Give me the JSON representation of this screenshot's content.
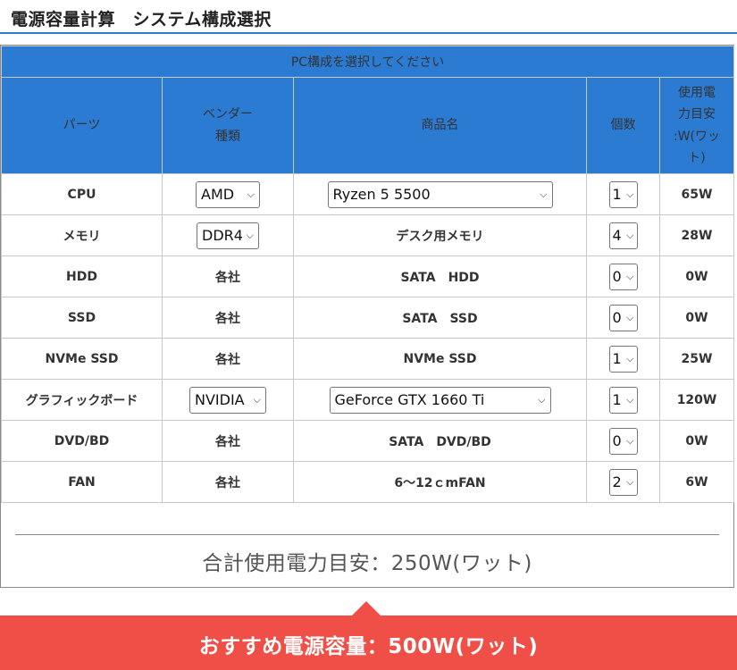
{
  "header": {
    "title": "電源容量計算　システム構成選択"
  },
  "table": {
    "caption": "PC構成を選択してください",
    "headers": {
      "parts": "パーツ",
      "vendor_line1": "ベンダー",
      "vendor_line2": "種類",
      "product": "商品名",
      "qty": "個数",
      "power_line1": "使用電",
      "power_line2": "力目安",
      "power_line3": ":W(ワッ",
      "power_line4": "ト)"
    },
    "rows": [
      {
        "part": "CPU",
        "vendor": "AMD",
        "product": "Ryzen 5 5500",
        "qty": "1",
        "watt": "65W"
      },
      {
        "part": "メモリ",
        "vendor": "DDR4",
        "product": "デスク用メモリ",
        "qty": "4",
        "watt": "28W"
      },
      {
        "part": "HDD",
        "vendor": "各社",
        "product": "SATA　HDD",
        "qty": "0",
        "watt": "0W"
      },
      {
        "part": "SSD",
        "vendor": "各社",
        "product": "SATA　SSD",
        "qty": "0",
        "watt": "0W"
      },
      {
        "part": "NVMe SSD",
        "vendor": "各社",
        "product": "NVMe SSD",
        "qty": "1",
        "watt": "25W"
      },
      {
        "part": "グラフィックボード",
        "vendor": "NVIDIA",
        "product": "GeForce GTX 1660 Ti",
        "qty": "1",
        "watt": "120W"
      },
      {
        "part": "DVD/BD",
        "vendor": "各社",
        "product": "SATA　DVD/BD",
        "qty": "0",
        "watt": "0W"
      },
      {
        "part": "FAN",
        "vendor": "各社",
        "product": "6～12ｃmFAN",
        "qty": "2",
        "watt": "6W"
      }
    ]
  },
  "total": {
    "text": "合計使用電力目安：250W(ワット)"
  },
  "recommend": {
    "text": "おすすめ電源容量：500W(ワット)"
  },
  "colors": {
    "header_blue": "#2b7bd2",
    "recommend_red": "#f04f47"
  }
}
